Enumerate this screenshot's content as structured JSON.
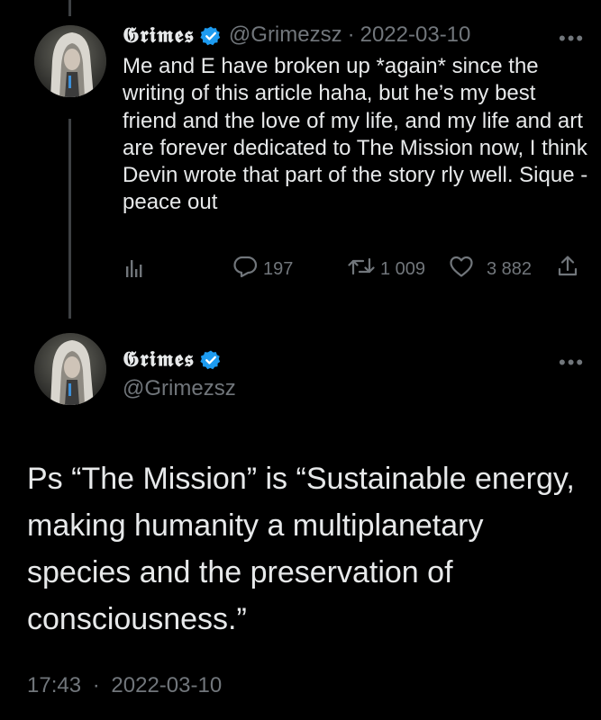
{
  "tweet1": {
    "display_name": "𝕲𝖗𝖎𝖒𝖊𝖘",
    "handle": "@Grimezsz",
    "separator": "·",
    "date": "2022-03-10",
    "more": "•••",
    "text": "Me and E have broken up *again* since the writing of this article haha, but he’s my best friend and the love of my life, and my life and art are forever dedicated to The Mission now, I think Devin wrote that part of the story rly well.   Sique - peace out",
    "replies": "197",
    "retweets": "1 009",
    "likes": "3 882"
  },
  "tweet2": {
    "display_name": "𝕲𝖗𝖎𝖒𝖊𝖘",
    "handle": "@Grimezsz",
    "more": "•••",
    "text": "Ps “The Mission” is “Sustainable energy, making humanity a multiplanetary species and the preservation of consciousness.”",
    "time": "17:43",
    "separator": "·",
    "date": "2022-03-10"
  },
  "colors": {
    "background": "#000000",
    "text": "#e7e9ea",
    "muted": "#71767b",
    "verified": "#1d9bf0",
    "thread_line": "#3e4144"
  },
  "icons": [
    "verified-badge-icon",
    "more-icon",
    "analytics-icon",
    "reply-icon",
    "retweet-icon",
    "like-icon",
    "share-icon"
  ]
}
